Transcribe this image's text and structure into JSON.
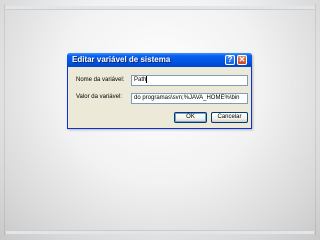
{
  "dialog": {
    "title": "Editar variável de sistema",
    "help_glyph": "?",
    "close_glyph": "✕",
    "name_label": "Nome da variável:",
    "name_value": "Path",
    "value_label": "Valor da variável:",
    "value_value": "do programas\\svn;%JAVA_HOME%\\bin",
    "ok_label": "OK",
    "cancel_label": "Cancelar"
  },
  "colors": {
    "titlebar": "#0054e3",
    "dialog_bg": "#ece9d8",
    "close": "#c7471e",
    "field_border": "#7f9db9"
  },
  "icons": {
    "help": "help-icon",
    "close": "close-icon"
  }
}
